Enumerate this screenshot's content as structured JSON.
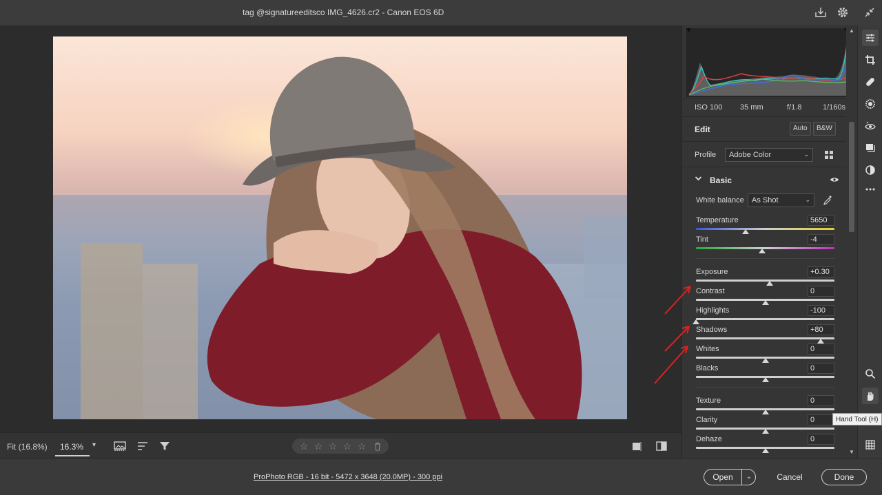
{
  "window": {
    "title": "tag @signatureeditsco IMG_4626.cr2  -  Canon EOS 6D",
    "icons": [
      "save-icon",
      "gear-icon",
      "minimize-icon"
    ]
  },
  "canvas_bar": {
    "fit_label": "Fit (16.8%)",
    "zoom_value": "16.3%",
    "icons": [
      "filmstrip-icon",
      "sort-icon",
      "filter-icon",
      "compare-icon",
      "before-after-icon"
    ],
    "rating_stars": 5
  },
  "panel": {
    "meta": {
      "iso": "ISO 100",
      "focal": "35 mm",
      "aperture": "f/1.8",
      "shutter": "1/160s"
    },
    "edit": {
      "title": "Edit",
      "auto_label": "Auto",
      "bw_label": "B&W"
    },
    "profile": {
      "label": "Profile",
      "value": "Adobe Color"
    },
    "basic": {
      "title": "Basic"
    },
    "white_balance": {
      "label": "White balance",
      "value": "As Shot"
    },
    "sliders": [
      {
        "label": "Temperature",
        "value": "5650",
        "level": 0.36
      },
      {
        "label": "Tint",
        "value": "-4",
        "level": 0.48
      },
      {
        "label": "Exposure",
        "value": "+0.30",
        "level": 0.53
      },
      {
        "label": "Contrast",
        "value": "0",
        "level": 0.5
      },
      {
        "label": "Highlights",
        "value": "-100",
        "level": 0.0
      },
      {
        "label": "Shadows",
        "value": "+80",
        "level": 0.9
      },
      {
        "label": "Whites",
        "value": "0",
        "level": 0.5
      },
      {
        "label": "Blacks",
        "value": "0",
        "level": 0.5
      },
      {
        "label": "Texture",
        "value": "0",
        "level": 0.5
      },
      {
        "label": "Clarity",
        "value": "0",
        "level": 0.5
      },
      {
        "label": "Dehaze",
        "value": "0",
        "level": 0.5
      }
    ]
  },
  "tooltip": "Hand Tool (H)",
  "status": {
    "file_info": "ProPhoto RGB - 16 bit - 5472 x 3648 (20.0MP) - 300 ppi",
    "open_label": "Open",
    "cancel_label": "Cancel",
    "done_label": "Done"
  },
  "colors": {
    "accent": "#e02020",
    "panel_bg": "#353535",
    "canvas_bg": "#2c2c2c"
  }
}
